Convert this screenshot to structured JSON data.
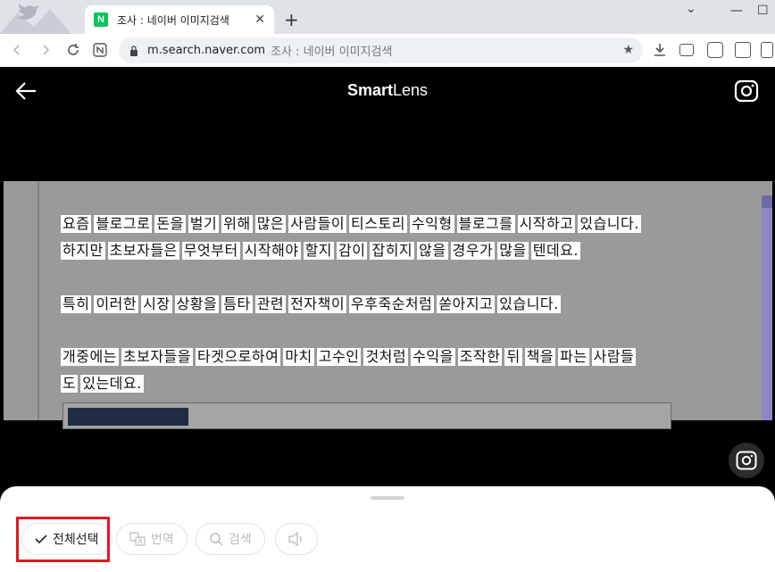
{
  "browser": {
    "tab_title": "조사 : 네이버 이미지검색",
    "favicon_letter": "N",
    "url": "m.search.naver.com",
    "page_title": "조사 : 네이버 이미지검색"
  },
  "lens": {
    "brand_bold": "Smart",
    "brand_light": "Lens"
  },
  "photo_text": {
    "line1": [
      "요즘",
      "블로그로",
      "돈을",
      "벌기",
      "위해",
      "많은",
      "사람들이",
      "티스토리",
      "수익형",
      "블로그를",
      "시작하고",
      "있습니다."
    ],
    "line2": [
      "하지만",
      "초보자들은",
      "무엇부터",
      "시작해야",
      "할지",
      "감이",
      "잡히지",
      "않을",
      "경우가",
      "많을",
      "텐데요."
    ],
    "line3": [
      "특히",
      "이러한",
      "시장",
      "상황을",
      "틈타",
      "관련",
      "전자책이",
      "우후죽순처럼",
      "쏟아지고",
      "있습니다."
    ],
    "line4": [
      "개중에는",
      "초보자들을",
      "타겟으로하여",
      "마치",
      "고수인",
      "것처럼",
      "수익을",
      "조작한",
      "뒤",
      "책을",
      "파는",
      "사람들"
    ],
    "line5": [
      "도",
      "있는데요."
    ]
  },
  "sheet": {
    "select_all": "전체선택",
    "translate": "번역",
    "search": "검색"
  },
  "colors": {
    "naver_green": "#03c75a",
    "highlight_red": "#e0181f",
    "scrollbar": "#8c88c8"
  }
}
